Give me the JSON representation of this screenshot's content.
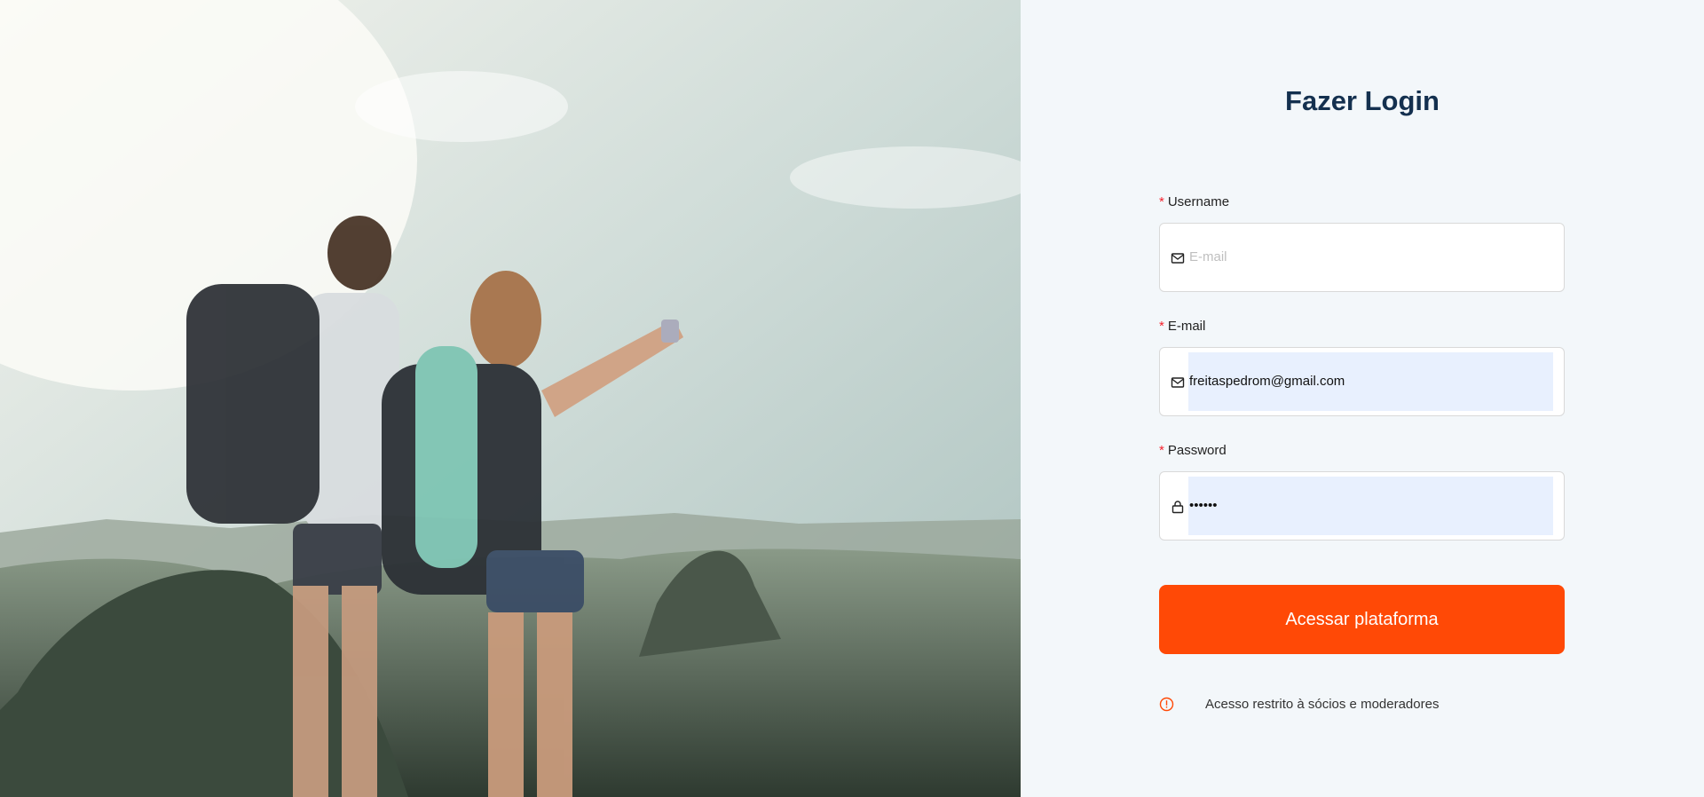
{
  "hero": {
    "image_description_icon": "hikers-mountain-photo"
  },
  "login": {
    "title": "Fazer Login",
    "username": {
      "label": "Username",
      "placeholder": "E-mail",
      "value": ""
    },
    "email": {
      "label": "E-mail",
      "value": "freitaspedrom@gmail.com"
    },
    "password": {
      "label": "Password",
      "value": "••••••"
    },
    "submit_label": "Acessar plataforma",
    "notice": "Acesso restrito à sócios e moderadores",
    "required_mark": "*"
  },
  "colors": {
    "accent": "#ff4906",
    "title": "#14304f",
    "autofill": "#e8f0fe",
    "required": "#f5222d"
  }
}
